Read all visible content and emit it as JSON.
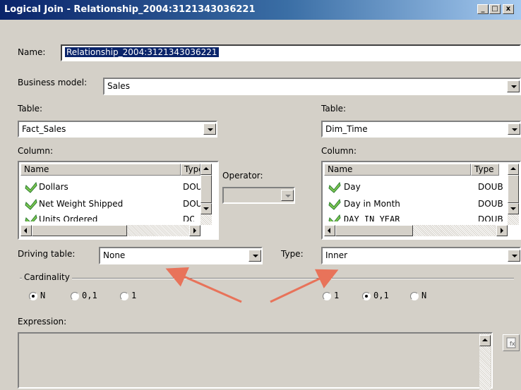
{
  "window": {
    "title": "Logical Join - Relationship_2004:3121343036221",
    "minimize_glyph": "_",
    "maximize_glyph": "□",
    "close_glyph": "x"
  },
  "name": {
    "label": "Name:",
    "value": "Relationship_2004:3121343036221"
  },
  "business_model": {
    "label": "Business model:",
    "value": "Sales"
  },
  "left": {
    "table_label": "Table:",
    "table_value": "Fact_Sales",
    "column_label": "Column:",
    "headers": [
      "Name",
      "Type"
    ],
    "rows": [
      {
        "name": "Dollars",
        "type": "DOU"
      },
      {
        "name": "Net Weight Shipped",
        "type": "DOU"
      },
      {
        "name": "Units Ordered",
        "type": "DOU"
      }
    ],
    "row_icon": "green-checkmark-icon"
  },
  "right": {
    "table_label": "Table:",
    "table_value": "Dim_Time",
    "column_label": "Column:",
    "headers": [
      "Name",
      "Type"
    ],
    "rows": [
      {
        "name": "Day",
        "type": "DOUB"
      },
      {
        "name": "Day in Month",
        "type": "DOUB"
      },
      {
        "name": "DAY_IN_YEAR",
        "type": "DOUB"
      }
    ],
    "row_icon": "green-checkmark-icon"
  },
  "operator": {
    "label": "Operator:",
    "value": ""
  },
  "driving_table": {
    "label": "Driving table:",
    "value": "None"
  },
  "type": {
    "label": "Type:",
    "value": "Inner"
  },
  "cardinality": {
    "label": "Cardinality",
    "left_options": [
      "N",
      "0,1",
      "1"
    ],
    "left_selected": "N",
    "right_options": [
      "1",
      "0,1",
      "N"
    ],
    "right_selected": "0,1"
  },
  "expression": {
    "label": "Expression:",
    "value": ""
  },
  "annotation": {
    "arrow_color": "#e8735a"
  },
  "colors": {
    "title_start": "#0a246a",
    "title_end": "#a6caf0",
    "selection": "#0a246a",
    "dialog_bg": "#d4d0c8"
  }
}
